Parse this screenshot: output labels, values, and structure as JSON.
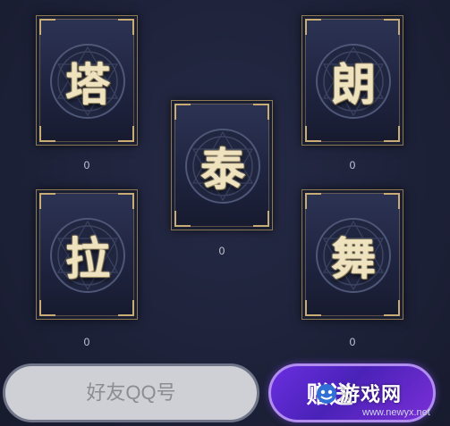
{
  "cards": [
    {
      "name": "card-ta",
      "glyph": "塔",
      "count": "0"
    },
    {
      "name": "card-lang",
      "glyph": "朗",
      "count": "0"
    },
    {
      "name": "card-tai",
      "glyph": "泰",
      "count": "0"
    },
    {
      "name": "card-la",
      "glyph": "拉",
      "count": "0"
    },
    {
      "name": "card-wu",
      "glyph": "舞",
      "count": "0"
    }
  ],
  "friend_input": {
    "placeholder": "好友QQ号",
    "value": ""
  },
  "gift_button": {
    "label": "赠送"
  },
  "watermark": {
    "title": "游戏网",
    "url": "www.newyx.net"
  },
  "colors": {
    "background": "#1d2138",
    "card_border": "#c9ad74",
    "glyph": "#efe3bf",
    "gift_button": "#5a28cc",
    "input_field": "#cfd0d5"
  }
}
